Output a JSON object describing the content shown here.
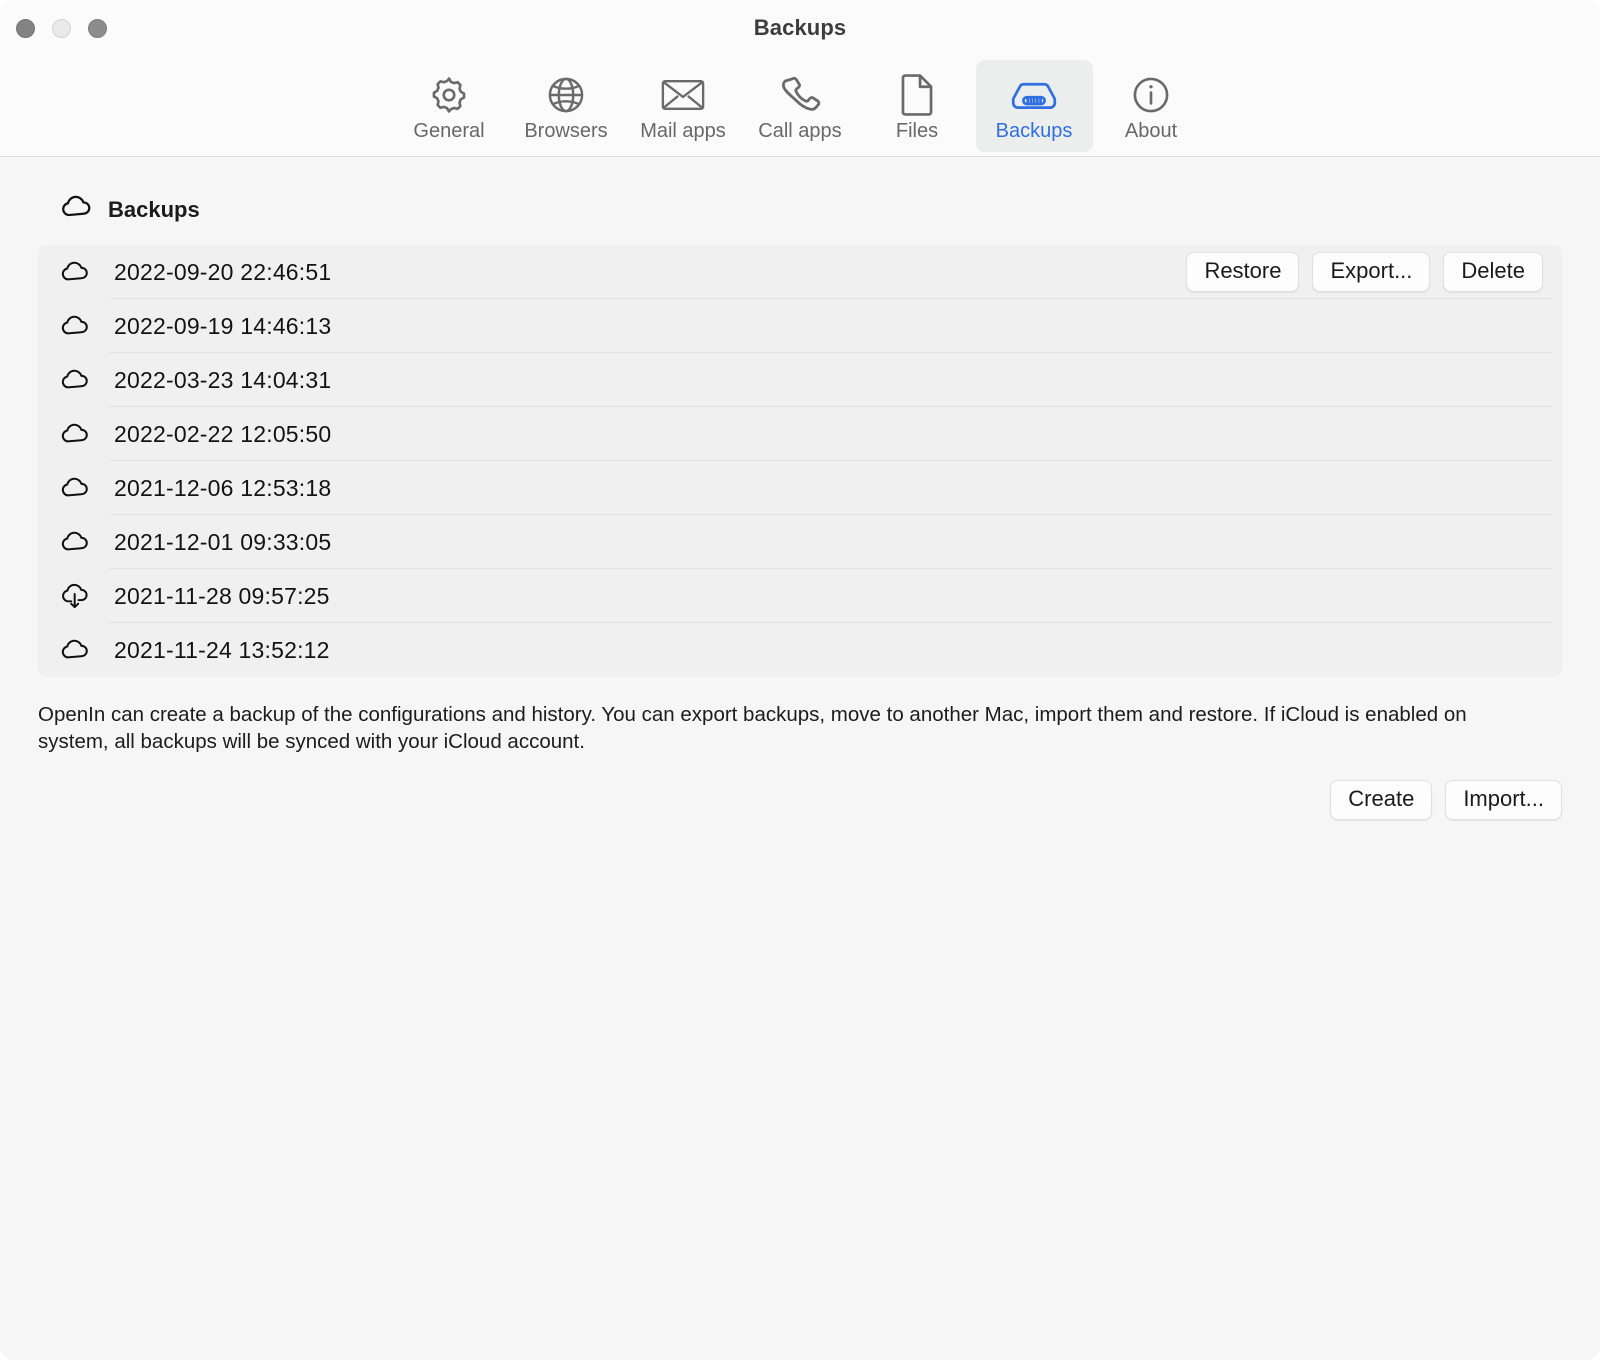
{
  "window": {
    "title": "Backups",
    "traffic_lights": [
      "close",
      "minimize",
      "zoom"
    ]
  },
  "toolbar": {
    "items": [
      {
        "label": "General",
        "icon": "gear-icon",
        "selected": false
      },
      {
        "label": "Browsers",
        "icon": "globe-icon",
        "selected": false
      },
      {
        "label": "Mail apps",
        "icon": "envelope-icon",
        "selected": false
      },
      {
        "label": "Call apps",
        "icon": "phone-icon",
        "selected": false
      },
      {
        "label": "Files",
        "icon": "document-icon",
        "selected": false
      },
      {
        "label": "Backups",
        "icon": "hard-drive-icon",
        "selected": true
      },
      {
        "label": "About",
        "icon": "info-icon",
        "selected": false
      }
    ],
    "selected_color": "#2f6fe0",
    "inactive_color": "#686868"
  },
  "section": {
    "icon": "cloud-icon",
    "title": "Backups"
  },
  "backups": {
    "row_actions": {
      "restore_label": "Restore",
      "export_label": "Export...",
      "delete_label": "Delete"
    },
    "items": [
      {
        "date": "2022-09-20 22:46:51",
        "icon": "cloud-icon",
        "selected": true
      },
      {
        "date": "2022-09-19 14:46:13",
        "icon": "cloud-icon",
        "selected": false
      },
      {
        "date": "2022-03-23 14:04:31",
        "icon": "cloud-icon",
        "selected": false
      },
      {
        "date": "2022-02-22 12:05:50",
        "icon": "cloud-icon",
        "selected": false
      },
      {
        "date": "2021-12-06 12:53:18",
        "icon": "cloud-icon",
        "selected": false
      },
      {
        "date": "2021-12-01 09:33:05",
        "icon": "cloud-icon",
        "selected": false
      },
      {
        "date": "2021-11-28 09:57:25",
        "icon": "cloud-download-icon",
        "selected": false
      },
      {
        "date": "2021-11-24 13:52:12",
        "icon": "cloud-icon",
        "selected": false
      }
    ]
  },
  "description": "OpenIn can create a backup of the configurations and history. You can export backups, move to another Mac, import them and restore. If iCloud is enabled on system, all backups will be synced with your iCloud account.",
  "bottom_actions": {
    "create_label": "Create",
    "import_label": "Import..."
  }
}
